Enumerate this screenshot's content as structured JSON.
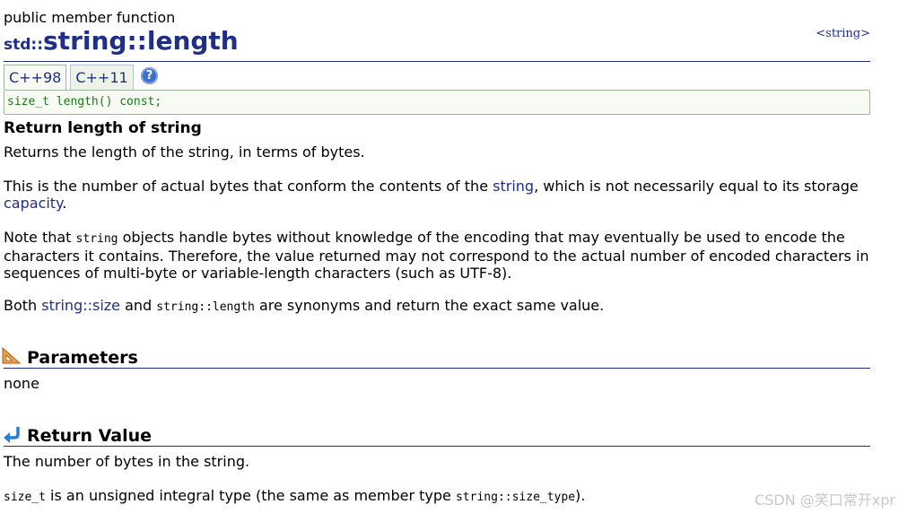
{
  "page": {
    "kind": "public member function",
    "title_ns": "std::",
    "title_class": "string",
    "title_sep": "::",
    "title_member": "length",
    "header_link": "<string>"
  },
  "tabs": [
    {
      "label": "C++98",
      "active": true
    },
    {
      "label": "C++11",
      "active": false
    }
  ],
  "help_icon": "?",
  "declaration": "size_t length() const;",
  "summary_heading": "Return length of string",
  "paragraphs": {
    "p1": "Returns the length of the string, in terms of bytes.",
    "p2_a": "This is the number of actual bytes that conform the contents of the ",
    "p2_link1": "string",
    "p2_b": ", which is not necessarily equal to its storage ",
    "p2_link2": "capacity",
    "p2_c": ".",
    "p3_a": "Note that ",
    "p3_code": "string",
    "p3_b": " objects handle bytes without knowledge of the encoding that may eventually be used to encode the characters it contains. Therefore, the value returned may not correspond to the actual number of encoded characters in sequences of multi-byte or variable-length characters (such as UTF-8).",
    "p4_a": "Both ",
    "p4_link": "string::size",
    "p4_b": " and ",
    "p4_code": "string::length",
    "p4_c": " are synonyms and return the exact same value."
  },
  "parameters": {
    "title": "Parameters",
    "icon": "ruler-triangle-icon",
    "body": "none"
  },
  "return_value": {
    "title": "Return Value",
    "icon": "return-arrow-icon",
    "body1": "The number of bytes in the string.",
    "body2_code1": "size_t",
    "body2_a": " is an unsigned integral type (the same as member type ",
    "body2_code2": "string::size_type",
    "body2_b": ")."
  },
  "watermark": "CSDN @笑口常开xpr",
  "colors": {
    "link": "#1f2e86",
    "decl_bg": "#f7fbf3",
    "decl_text": "#1a7a1a",
    "rule": "#1f2e86"
  }
}
